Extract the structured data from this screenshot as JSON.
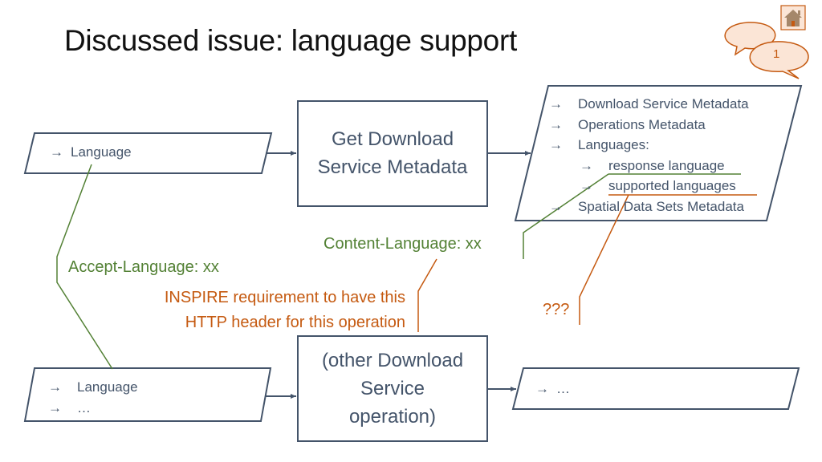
{
  "slide": {
    "title": "Discussed issue: language support",
    "comment_badge": "1",
    "home_icon": "home-icon",
    "comment_icon": "speech-bubble-icon"
  },
  "diagram": {
    "arrow_glyph": "→",
    "input_top": {
      "items": [
        "Language"
      ]
    },
    "operation_top": {
      "label_line1": "Get Download",
      "label_line2": "Service Metadata"
    },
    "output_top": {
      "items": [
        "Download Service Metadata",
        "Operations Metadata",
        "Languages:",
        "response language",
        "supported languages",
        "Spatial Data Sets Metadata"
      ]
    },
    "input_bottom": {
      "items": [
        "Language",
        "…"
      ]
    },
    "operation_bottom": {
      "label_line1": "(other Download",
      "label_line2": "Service",
      "label_line3": "operation)"
    },
    "output_bottom": {
      "items": [
        "…"
      ]
    },
    "annotations": {
      "accept_language": "Accept-Language: xx",
      "content_language": "Content-Language: xx",
      "inspire_line1": "INSPIRE requirement to have this",
      "inspire_line2": "HTTP header for this operation",
      "question": "???"
    },
    "colors": {
      "shape_stroke": "#44546a",
      "green": "#538135",
      "orange": "#c55a11",
      "bubble_fill": "#fbe5d6",
      "bubble_stroke": "#c55a11"
    }
  }
}
